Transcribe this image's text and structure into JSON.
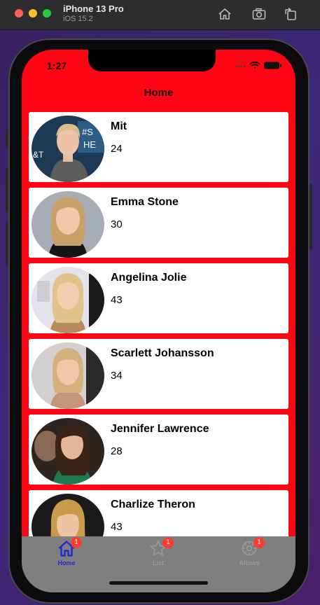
{
  "simulator": {
    "device_name": "iPhone 13 Pro",
    "os_version": "iOS 15.2",
    "toolbar_icons": [
      "home-icon",
      "screenshot-icon",
      "rotate-icon"
    ]
  },
  "status_bar": {
    "time": "1:27",
    "icons": [
      "signal-dots-icon",
      "wifi-icon",
      "battery-icon"
    ]
  },
  "nav": {
    "title": "Home"
  },
  "people": [
    {
      "name": "Mit",
      "age": "24"
    },
    {
      "name": "Emma Stone",
      "age": "30"
    },
    {
      "name": "Angelina Jolie",
      "age": "43"
    },
    {
      "name": "Scarlett Johansson",
      "age": "34"
    },
    {
      "name": "Jennifer Lawrence",
      "age": "28"
    },
    {
      "name": "Charlize Theron",
      "age": "43"
    }
  ],
  "tabs": [
    {
      "label": "Home",
      "badge": "1",
      "icon": "house-icon",
      "active": true
    },
    {
      "label": "List",
      "badge": "1",
      "icon": "star-icon",
      "active": false
    },
    {
      "label": "Allows",
      "badge": "1",
      "icon": "gear-icon",
      "active": false
    }
  ],
  "colors": {
    "app_background": "#ff0414",
    "tab_active": "#1f2bd6",
    "tab_inactive": "#9a9a9a",
    "badge": "#ff3b30"
  }
}
